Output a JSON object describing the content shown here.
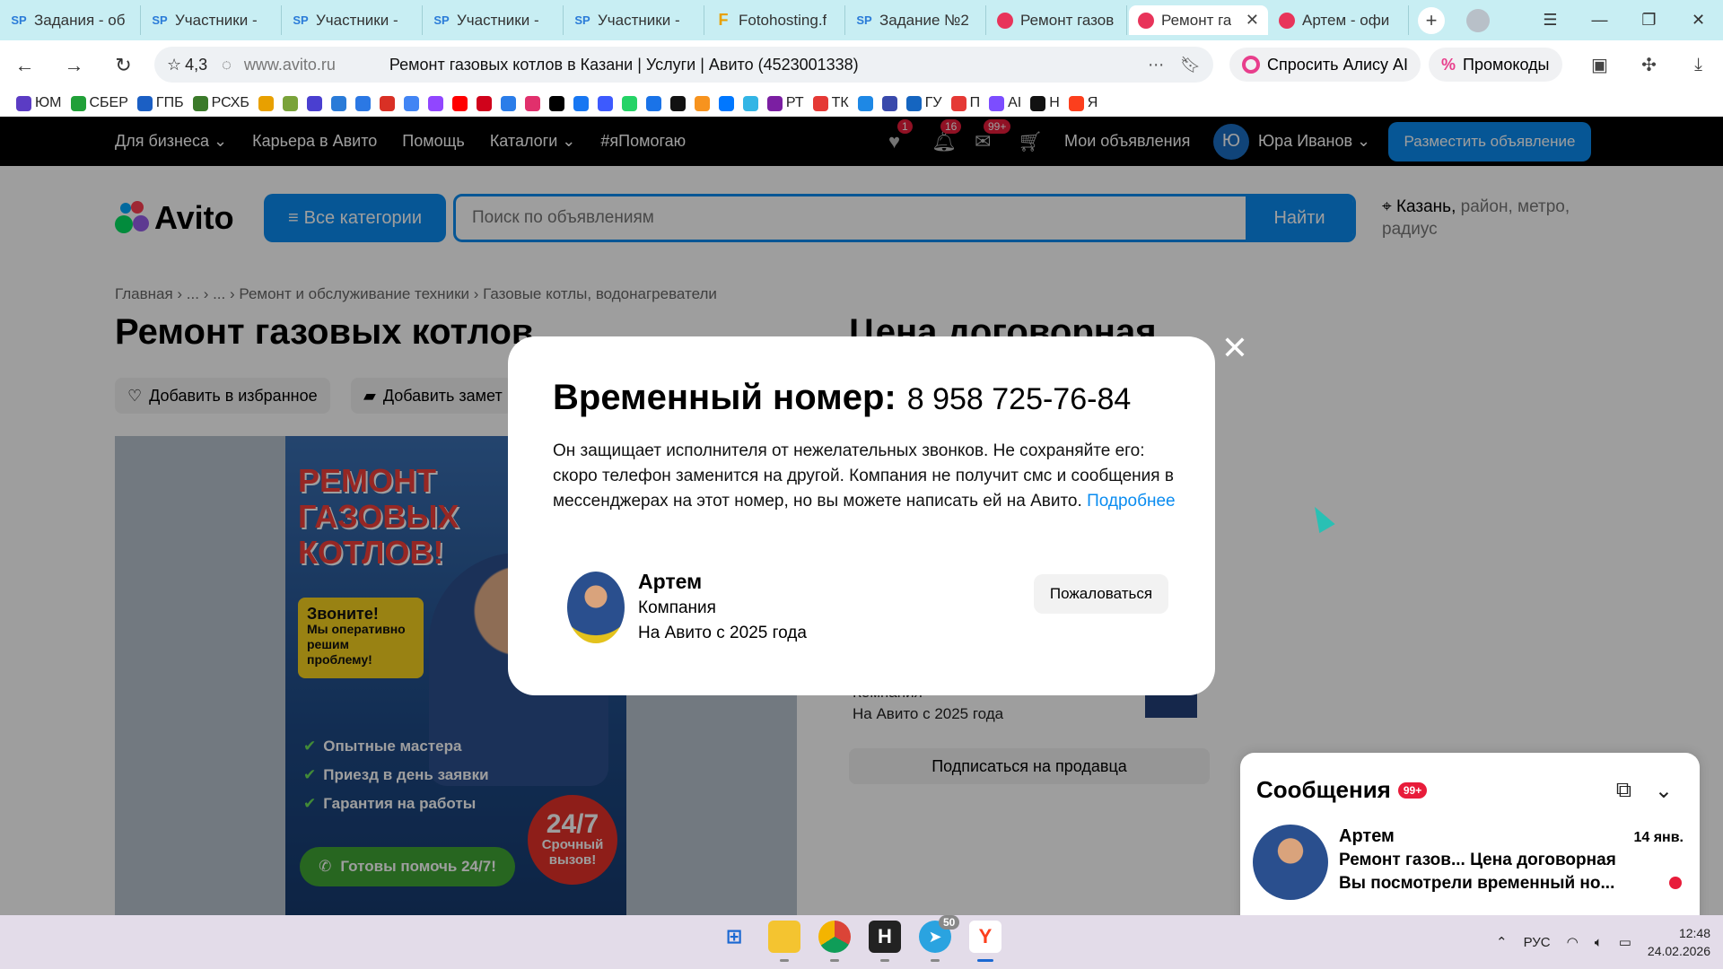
{
  "browser": {
    "tabs": [
      {
        "icon": "SP",
        "label": "Задания - об"
      },
      {
        "icon": "SP",
        "label": "Участники - "
      },
      {
        "icon": "SP",
        "label": "Участники - "
      },
      {
        "icon": "SP",
        "label": "Участники - "
      },
      {
        "icon": "SP",
        "label": "Участники - "
      },
      {
        "icon": "F",
        "label": "Fotohosting.f"
      },
      {
        "icon": "SP",
        "label": "Задание №2"
      },
      {
        "icon": "",
        "label": "Ремонт газов"
      },
      {
        "icon": "",
        "label": "Ремонт га",
        "active": true
      },
      {
        "icon": "",
        "label": "Артем - офи"
      }
    ],
    "rating": "4,3",
    "host": "www.avito.ru",
    "page_title": "Ремонт газовых котлов в Казани | Услуги | Авито (4523001338)",
    "alice_label": "Спросить Алису AI",
    "promo_label": "Промокоды",
    "bookmarks": [
      {
        "label": "ЮМ",
        "color": "#5b3cc4"
      },
      {
        "label": "СБЕР",
        "color": "#21a038"
      },
      {
        "label": "ГПБ",
        "color": "#1b5fc4"
      },
      {
        "label": "РСХБ",
        "color": "#3b7a2a"
      },
      {
        "label": "",
        "color": "#e8a000"
      },
      {
        "label": "",
        "color": "#7aa33a"
      },
      {
        "label": "",
        "color": "#4a3fd0"
      },
      {
        "label": "",
        "color": "#2a7bd8"
      },
      {
        "label": "",
        "color": "#2b78e4"
      },
      {
        "label": "",
        "color": "#d93025"
      },
      {
        "label": "",
        "color": "#4285f4"
      },
      {
        "label": "",
        "color": "#9146ff"
      },
      {
        "label": "",
        "color": "#ff0000"
      },
      {
        "label": "",
        "color": "#d0021b"
      },
      {
        "label": "",
        "color": "#2b7de9"
      },
      {
        "label": "",
        "color": "#e1306c"
      },
      {
        "label": "",
        "color": "#000000"
      },
      {
        "label": "",
        "color": "#1877f2"
      },
      {
        "label": "",
        "color": "#3d5afe"
      },
      {
        "label": "",
        "color": "#25d366"
      },
      {
        "label": "",
        "color": "#1a73e8"
      },
      {
        "label": "",
        "color": "#111111"
      },
      {
        "label": "",
        "color": "#f7931e"
      },
      {
        "label": "",
        "color": "#0077ff"
      },
      {
        "label": "",
        "color": "#33b5e5"
      },
      {
        "label": "РТ",
        "color": "#7b1fa2"
      },
      {
        "label": "ТК",
        "color": "#e53935"
      },
      {
        "label": "",
        "color": "#1e88e5"
      },
      {
        "label": "",
        "color": "#3949ab"
      },
      {
        "label": "ГУ",
        "color": "#1565c0"
      },
      {
        "label": "П",
        "color": "#e53935"
      },
      {
        "label": "AI",
        "color": "#7c4dff"
      },
      {
        "label": "Н",
        "color": "#111111"
      },
      {
        "label": "Я",
        "color": "#fc3f1d"
      }
    ]
  },
  "topnav": {
    "links": [
      "Для бизнеса ⌄",
      "Карьера в Авито",
      "Помощь",
      "Каталоги ⌄",
      "#яПомогаю"
    ],
    "fav_badge": "1",
    "notif_badge": "16",
    "msg_badge": "99+",
    "my_ads": "Мои объявления",
    "user_initial": "Ю",
    "user_name": "Юра Иванов ⌄",
    "post_button": "Разместить объявление"
  },
  "header": {
    "logo": "Avito",
    "categories_button": "Все категории",
    "search_placeholder": "Поиск по объявлениям",
    "find_button": "Найти",
    "location_city": "Казань,",
    "location_rest": " район, метро, радиус"
  },
  "listing": {
    "breadcrumbs": "Главная  ›  ...  ›  ...  ›  Ремонт и обслуживание техники  ›  Газовые котлы, водонагреватели",
    "title": "Ремонт газовых котлов",
    "price": "Цена договорная",
    "fav_button": "Добавить в избранное",
    "note_button": "Добавить замет",
    "poster": {
      "headline": "РЕМОНТ ГАЗОВЫХ КОТЛОВ!",
      "call_title": "Звоните!",
      "call_text": "Мы оперативно решим проблему!",
      "features": [
        "Опытные мастера",
        "Приезд в день заявки",
        "Гарантия на работы"
      ],
      "badge_big": "24/7",
      "badge_small": "Срочный вызов!",
      "ready": "Готовы помочь 24/7!"
    },
    "seller_type_bg": "Компания",
    "seller_since_bg": "На Авито с 2025 года",
    "subscribe_button": "Подписаться на продавца"
  },
  "modal": {
    "title": "Временный номер:",
    "phone": "8 958 725-76-84",
    "text": "Он защищает исполнителя от нежелательных звонков. Не сохраняйте его: скоро телефон заменится на другой. Компания не получит смс и сообщения в мессенджерах на этот номер, но вы можете написать ей на Авито.",
    "more_link": "Подробнее",
    "seller_name": "Артем",
    "seller_type": "Компания",
    "seller_since": "На Авито с 2025 года",
    "report_button": "Пожаловаться"
  },
  "messenger": {
    "title": "Сообщения",
    "badge": "99+",
    "name": "Артем",
    "date": "14 янв.",
    "line1": "Ремонт газов... Цена договорная",
    "line2": "Вы посмотрели временный но..."
  },
  "taskbar": {
    "telegram_badge": "50",
    "lang": "РУС",
    "time": "12:48",
    "date": "24.02.2026"
  }
}
